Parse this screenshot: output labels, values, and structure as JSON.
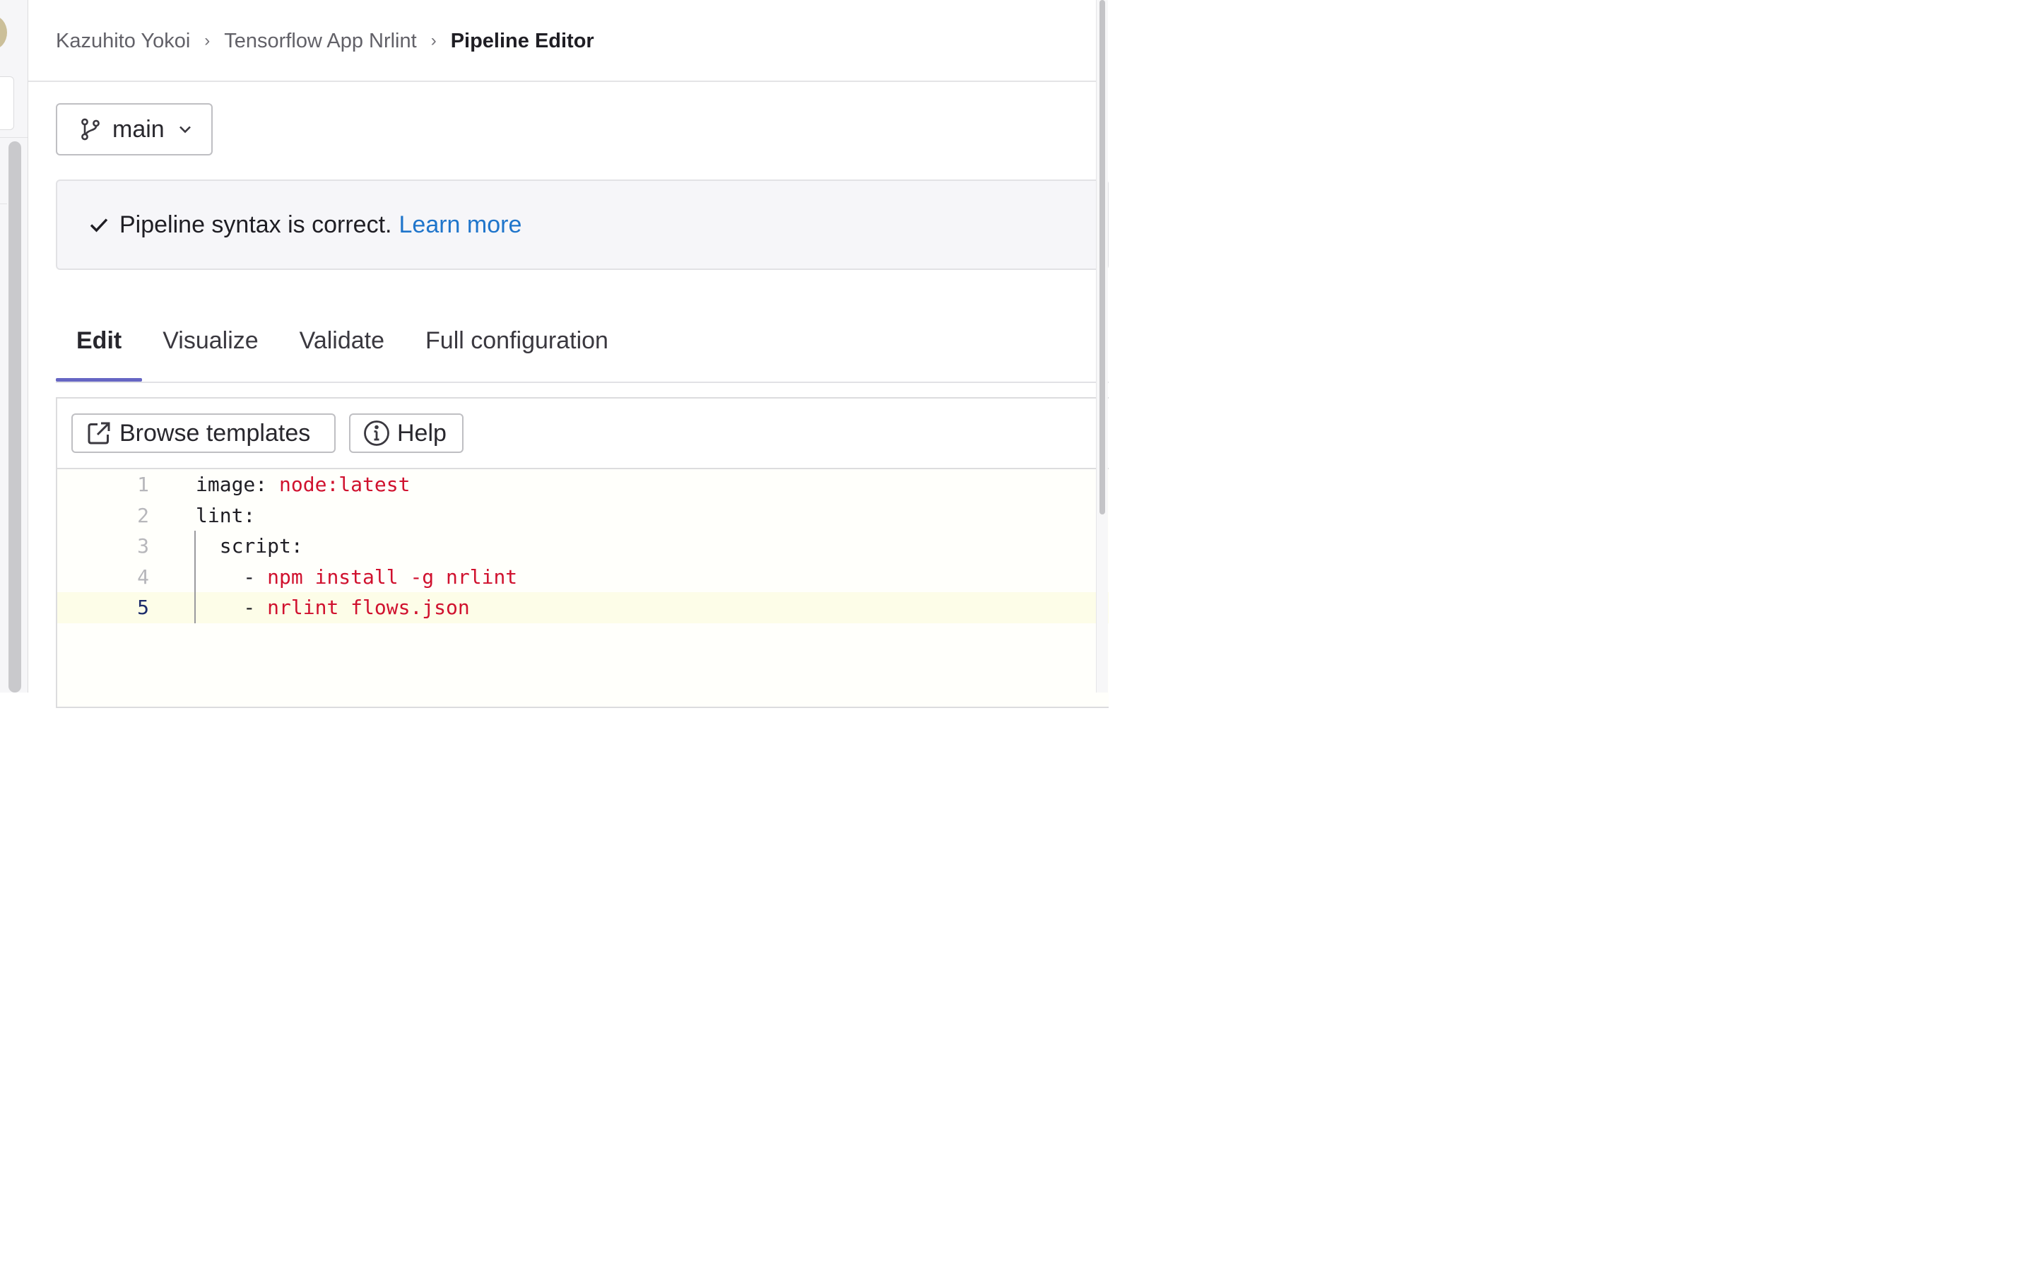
{
  "breadcrumb": {
    "items": [
      "Kazuhito Yokoi",
      "Tensorflow App Nrlint",
      "Pipeline Editor"
    ],
    "separator": "›"
  },
  "branch": {
    "label": "main"
  },
  "alert": {
    "text": "Pipeline syntax is correct.",
    "link": "Learn more"
  },
  "tabs": [
    {
      "label": "Edit",
      "active": true
    },
    {
      "label": "Visualize",
      "active": false
    },
    {
      "label": "Validate",
      "active": false
    },
    {
      "label": "Full configuration",
      "active": false
    }
  ],
  "toolbar": {
    "browse_templates": "Browse templates",
    "help": "Help"
  },
  "editor": {
    "current_line": 5,
    "lines": [
      {
        "num": "1",
        "key": "image: ",
        "value": "node:latest"
      },
      {
        "num": "2",
        "key": "lint:",
        "value": ""
      },
      {
        "num": "3",
        "key": "  script:",
        "value": ""
      },
      {
        "num": "4",
        "key": "    - ",
        "value": "npm install -g nrlint"
      },
      {
        "num": "5",
        "key": "    - ",
        "value": "nrlint flows.json"
      }
    ]
  },
  "colors": {
    "link": "#1f75cb",
    "active_tab_underline": "#6666c4",
    "yaml_string": "#d0112e",
    "current_line_bg": "#fdfde8"
  }
}
